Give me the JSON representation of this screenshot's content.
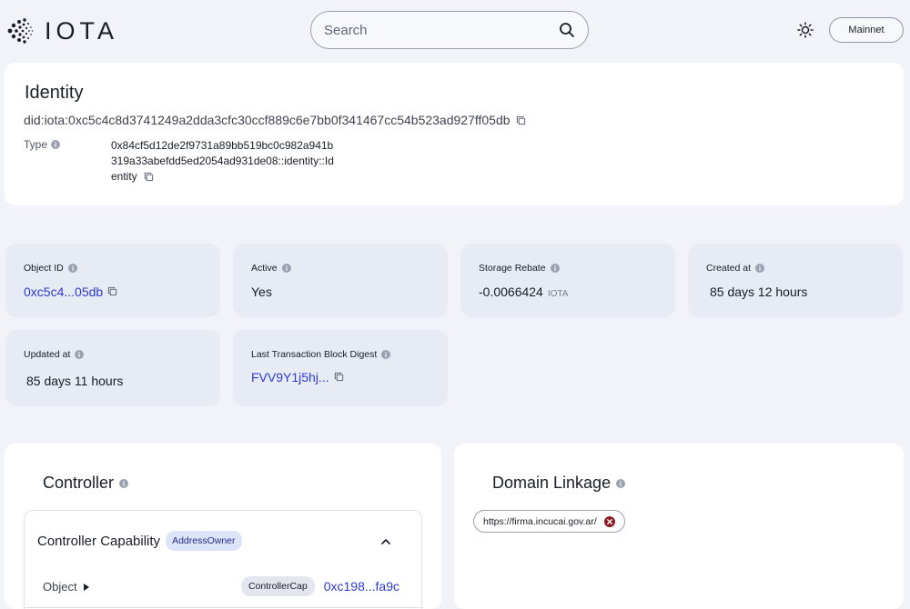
{
  "header": {
    "logo_text": "IOTA",
    "search": {
      "placeholder": "Search",
      "value": ""
    },
    "network": "Mainnet"
  },
  "identity": {
    "title": "Identity",
    "did": "did:iota:0xc5c4c8d3741249a2dda3cfc30ccf889c6e7bb0f341467cc54b523ad927ff05db",
    "type_label": "Type",
    "type_value": "0x84cf5d12de2f9731a89bb519bc0c982a941b319a33abefdd5ed2054ad931de08::identity::Identity"
  },
  "stats": [
    {
      "label": "Object ID",
      "value": "0xc5c4...05db",
      "unit": "",
      "link": true
    },
    {
      "label": "Active",
      "value": "Yes",
      "unit": "",
      "link": false
    },
    {
      "label": "Storage Rebate",
      "value": "-0.0066424",
      "unit": "IOTA",
      "link": false
    },
    {
      "label": "Created at",
      "value": "85 days 12 hours",
      "unit": "",
      "link": false
    },
    {
      "label": "Updated at",
      "value": "85 days 11 hours",
      "unit": "",
      "link": false
    },
    {
      "label": "Last Transaction Block Digest",
      "value": "FVV9Y1j5hj...",
      "unit": "",
      "link": true
    }
  ],
  "controller": {
    "title": "Controller",
    "capability_title": "Controller Capability",
    "badge": "AddressOwner",
    "object_label": "Object",
    "object_tag": "ControllerCap",
    "object_id": "0xc198...fa9c"
  },
  "domain_linkage": {
    "title": "Domain Linkage",
    "domains": [
      "https://firma.incucai.gov.ar/"
    ]
  },
  "colors": {
    "accent": "#2c3ad6",
    "card_bg": "#e7ebf3",
    "page_bg": "#f1f3f8",
    "error": "#8b1c24"
  },
  "icons": [
    "iota-logo-icon",
    "search-icon",
    "sun-icon",
    "info-icon",
    "copy-icon",
    "chevron-up-icon",
    "triangle-right-icon",
    "close-circle-icon"
  ]
}
